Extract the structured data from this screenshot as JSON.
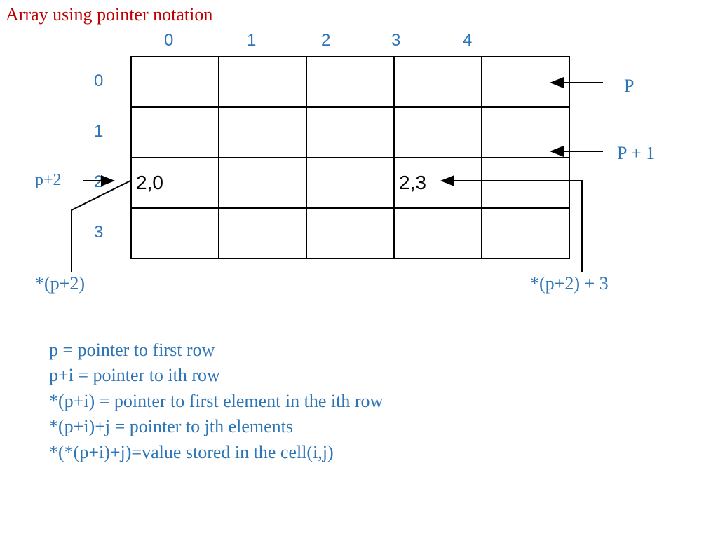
{
  "title": "Array using pointer notation",
  "columns": [
    "0",
    "1",
    "2",
    "3",
    "4"
  ],
  "rows": [
    "0",
    "1",
    "2",
    "3"
  ],
  "cells": {
    "r2c0": "2,0",
    "r2c3": "2,3"
  },
  "annotations": {
    "P": "P",
    "Pplus1": "P + 1",
    "pplus2": "p+2",
    "star_p2": "*(p+2)",
    "star_p2_3": "*(p+2) + 3"
  },
  "explanations": [
    "p = pointer to first row",
    "p+i = pointer to ith row",
    "*(p+i) = pointer to first element in the ith row",
    "*(p+i)+j = pointer to jth elements",
    "*(*(p+i)+j)=value stored in the cell(i,j)"
  ]
}
